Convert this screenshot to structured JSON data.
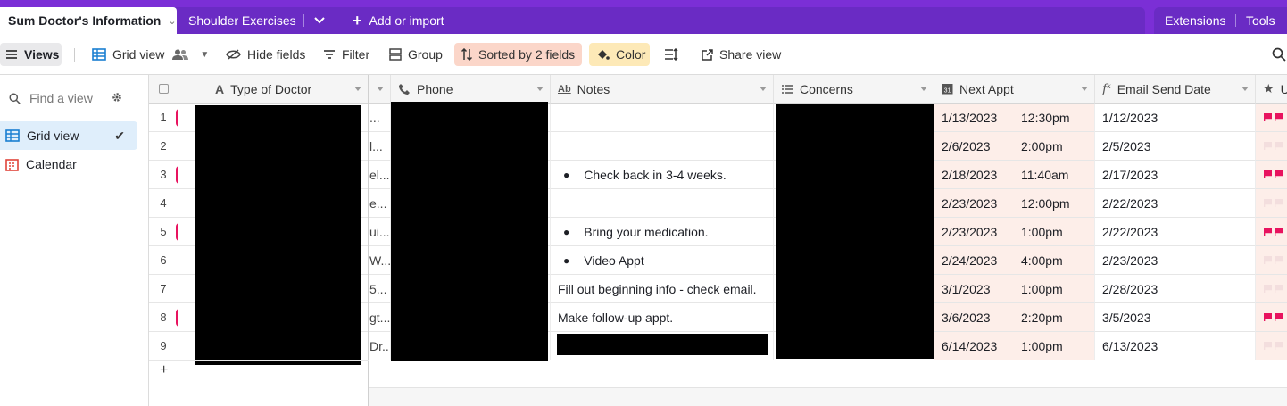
{
  "tabs": {
    "active": "Sum Doctor's Information",
    "second": "Shoulder Exercises",
    "add_import": "Add or import",
    "extensions": "Extensions",
    "tools": "Tools"
  },
  "toolbar": {
    "views": "Views",
    "grid_view": "Grid view",
    "hide_fields": "Hide fields",
    "filter": "Filter",
    "group": "Group",
    "sorted": "Sorted by 2 fields",
    "color": "Color",
    "share_view": "Share view"
  },
  "sidebar": {
    "find_placeholder": "Find a view",
    "items": [
      {
        "label": "Grid view",
        "active": true
      },
      {
        "label": "Calendar",
        "active": false
      }
    ]
  },
  "columns": {
    "type_of_doctor": "Type of Doctor",
    "phone": "Phone",
    "notes": "Notes",
    "concerns": "Concerns",
    "next_appt": "Next Appt",
    "email_send_date": "Email Send Date",
    "urgent_short": "U"
  },
  "rows": [
    {
      "n": "1",
      "flag": true,
      "partial": "...",
      "notes": "",
      "bullet": false,
      "date": "1/13/2023",
      "time": "12:30pm",
      "email": "1/12/2023"
    },
    {
      "n": "2",
      "flag": false,
      "partial": "l...",
      "notes": "",
      "bullet": false,
      "date": "2/6/2023",
      "time": "2:00pm",
      "email": "2/5/2023"
    },
    {
      "n": "3",
      "flag": true,
      "partial": "el...",
      "notes": "Check back in 3-4 weeks.",
      "bullet": true,
      "date": "2/18/2023",
      "time": "11:40am",
      "email": "2/17/2023"
    },
    {
      "n": "4",
      "flag": false,
      "partial": "e...",
      "notes": "",
      "bullet": false,
      "date": "2/23/2023",
      "time": "12:00pm",
      "email": "2/22/2023"
    },
    {
      "n": "5",
      "flag": true,
      "partial": "ui...",
      "notes": "Bring your medication.",
      "bullet": true,
      "date": "2/23/2023",
      "time": "1:00pm",
      "email": "2/22/2023"
    },
    {
      "n": "6",
      "flag": false,
      "partial": "W...",
      "notes": "Video Appt",
      "bullet": true,
      "date": "2/24/2023",
      "time": "4:00pm",
      "email": "2/23/2023"
    },
    {
      "n": "7",
      "flag": false,
      "partial": "5...",
      "notes": "Fill out beginning info - check email.",
      "bullet": false,
      "date": "3/1/2023",
      "time": "1:00pm",
      "email": "2/28/2023"
    },
    {
      "n": "8",
      "flag": true,
      "partial": "gt...",
      "notes": "Make follow-up appt.",
      "bullet": false,
      "date": "3/6/2023",
      "time": "2:20pm",
      "email": "3/5/2023"
    },
    {
      "n": "9",
      "flag": false,
      "partial": "Dr...",
      "notes": "",
      "bullet": false,
      "date": "6/14/2023",
      "time": "1:00pm",
      "email": "6/13/2023"
    }
  ],
  "add_row": "+"
}
